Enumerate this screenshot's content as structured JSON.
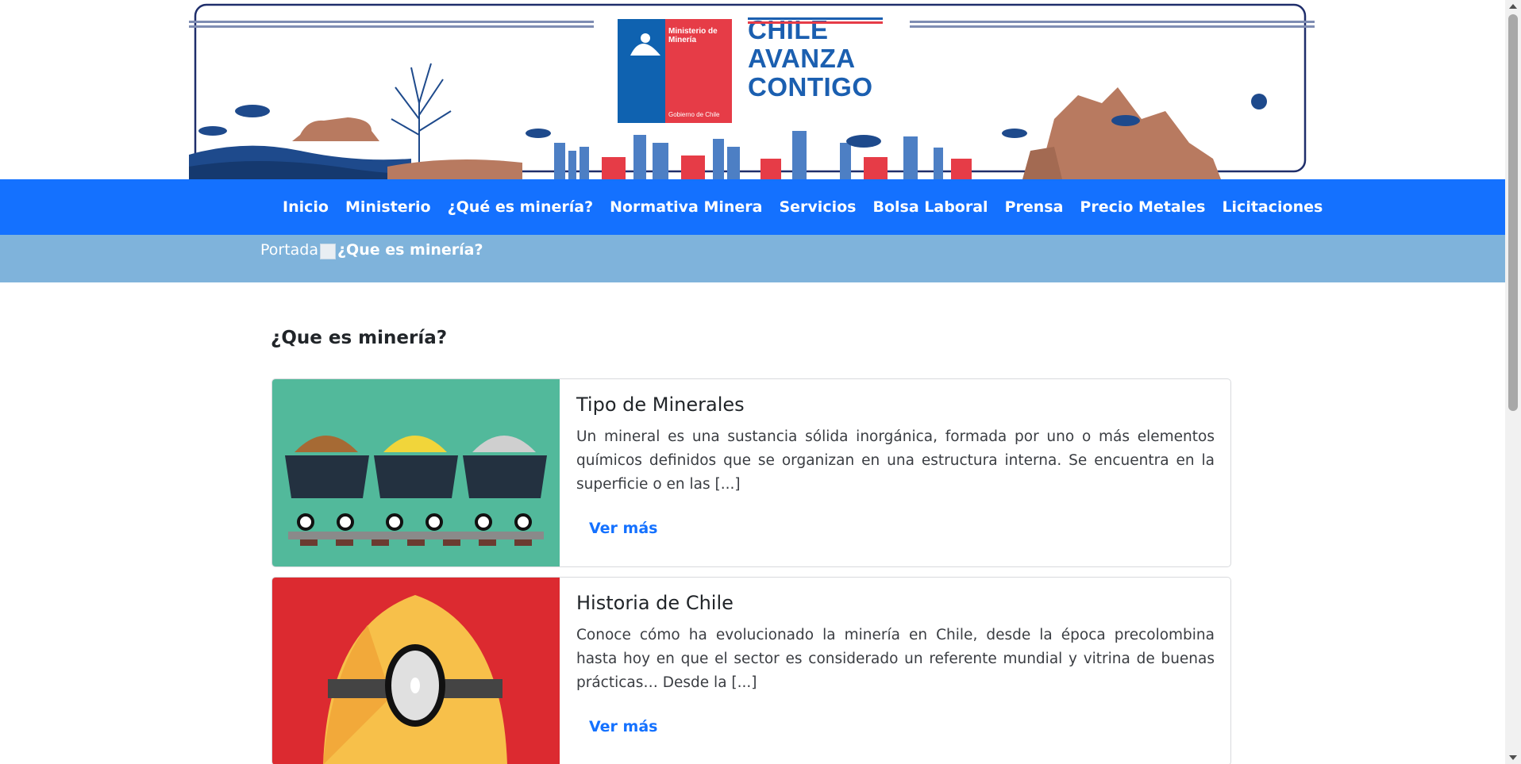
{
  "banner": {
    "ministry_label": "Ministerio de Minería",
    "gov_label": "Gobierno de Chile",
    "slogan_lines": [
      "CHILE",
      "AVANZA",
      "CONTIGO"
    ]
  },
  "nav": {
    "items": [
      {
        "label": "Inicio"
      },
      {
        "label": "Ministerio"
      },
      {
        "label": "¿Qué es minería?"
      },
      {
        "label": "Normativa Minera"
      },
      {
        "label": "Servicios"
      },
      {
        "label": "Bolsa Laboral"
      },
      {
        "label": "Prensa"
      },
      {
        "label": "Precio Metales"
      },
      {
        "label": "Licitaciones"
      }
    ]
  },
  "breadcrumb": {
    "home": "Portada",
    "current": "¿Que es minería?"
  },
  "page": {
    "title": "¿Que es minería?"
  },
  "cards": [
    {
      "title": "Tipo de Minerales",
      "excerpt": "Un mineral es una sustancia sólida inorgánica, formada por uno o más elementos químicos definidos que se organizan en una estructura interna. Se encuentra en la superficie o en las [...]",
      "more": "Ver más",
      "bg_color": "#52b99b"
    },
    {
      "title": "Historia de Chile",
      "excerpt": "Conoce cómo ha evolucionado la minería en Chile, desde la época precolombina hasta hoy en que el sector es considerado un referente mundial y vitrina de buenas prácticas… Desde la [...]",
      "more": "Ver más",
      "bg_color": "#dc2a30"
    }
  ],
  "colors": {
    "nav_bg": "#1471ff",
    "breadcrumb_bg": "#7fb3db",
    "link": "#1471ff",
    "brand_blue": "#0f62b0",
    "brand_red": "#e63c47"
  }
}
